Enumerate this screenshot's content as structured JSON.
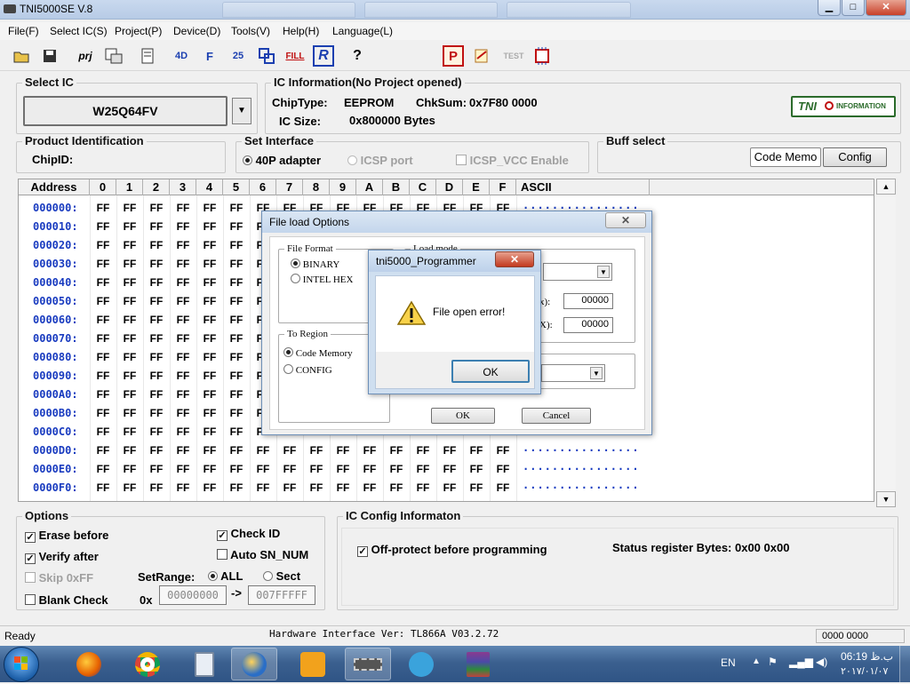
{
  "window": {
    "title": "TNI5000SE V.8"
  },
  "menu": [
    "File(F)",
    "Select IC(S)",
    "Project(P)",
    "Device(D)",
    "Tools(V)",
    "Help(H)",
    "Language(L)"
  ],
  "toolbar": {
    "prj_label": "prj",
    "fill_label": "FILL",
    "test_label": "TEST",
    "r_label": "R",
    "d_label": "4D",
    "f_label": "F",
    "s_label": "25"
  },
  "select_ic": {
    "label": "Select IC",
    "value": "W25Q64FV"
  },
  "ic_info": {
    "label": "IC Information(No Project opened)",
    "chiptype_label": "ChipType:",
    "chiptype": "EEPROM",
    "chksum_label": "ChkSum:",
    "chksum": "0x7F80 0000",
    "size_label": "IC Size:",
    "size": "0x800000 Bytes",
    "logo_text": "TNI",
    "logo_sub": "INFORMATION"
  },
  "product_id": {
    "label": "Product Identification",
    "chipid_label": "ChipID:"
  },
  "interface": {
    "label": "Set Interface",
    "opt1": "40P adapter",
    "opt2": "ICSP port",
    "opt3": "ICSP_VCC Enable"
  },
  "buff": {
    "label": "Buff select",
    "tab1": "Code Memo",
    "tab2": "Config"
  },
  "grid": {
    "headers": [
      "Address",
      "0",
      "1",
      "2",
      "3",
      "4",
      "5",
      "6",
      "7",
      "8",
      "9",
      "A",
      "B",
      "C",
      "D",
      "E",
      "F",
      "ASCII"
    ],
    "addresses": [
      "000000:",
      "000010:",
      "000020:",
      "000030:",
      "000040:",
      "000050:",
      "000060:",
      "000070:",
      "000080:",
      "000090:",
      "0000A0:",
      "0000B0:",
      "0000C0:",
      "0000D0:",
      "0000E0:",
      "0000F0:"
    ],
    "byte": "FF",
    "ascii": "................"
  },
  "file_dialog": {
    "title": "File load Options",
    "format_label": "File Format",
    "binary": "BINARY",
    "intel": "INTEL HEX",
    "load_label": "Load mode",
    "field1_suffix": "x):",
    "field1": "00000",
    "field2_suffix": "X):",
    "field2": "00000",
    "region_label": "To Region",
    "code": "Code Memory",
    "config": "CONFIG",
    "ok": "OK",
    "cancel": "Cancel"
  },
  "msgbox": {
    "title": "tni5000_Programmer",
    "message": "File open error!",
    "ok": "OK"
  },
  "options": {
    "label": "Options",
    "erase": "Erase before",
    "verify": "Verify after",
    "skip": "Skip 0xFF",
    "blank": "Blank Check",
    "checkid": "Check ID",
    "autosn": "Auto SN_NUM",
    "setrange": "SetRange:",
    "all": "ALL",
    "sect": "Sect",
    "hex_prefix": "0x",
    "from": "00000000",
    "arrow": "->",
    "to": "007FFFFF"
  },
  "ic_config": {
    "label": "IC Config Informaton",
    "offprotect": "Off-protect before programming",
    "status": "Status register Bytes: 0x00 0x00"
  },
  "status": {
    "left": "Ready",
    "center": "Hardware Interface Ver: TL866A V03.2.72",
    "right": "0000 0000"
  },
  "tray": {
    "lang": "EN",
    "time": "06:19 ب.ظ",
    "date": "۲۰۱۷/۰۱/۰۷"
  }
}
